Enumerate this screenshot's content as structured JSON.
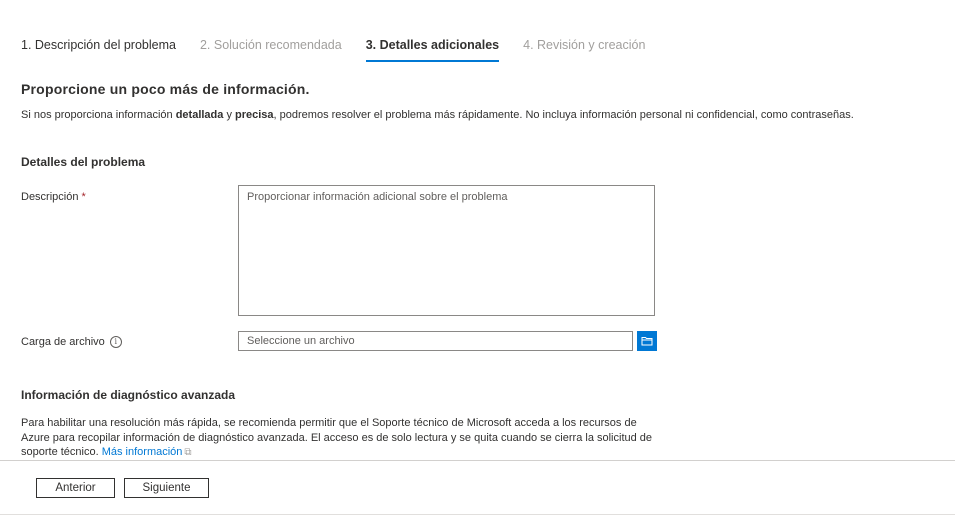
{
  "tabs": [
    {
      "label": "1. Descripción del problema",
      "state": "done"
    },
    {
      "label": "2. Solución recomendada",
      "state": "disabled"
    },
    {
      "label": "3. Detalles adicionales",
      "state": "active"
    },
    {
      "label": "4. Revisión y creación",
      "state": "disabled"
    }
  ],
  "page_title": "Proporcione un poco más de información.",
  "intro": {
    "part1": "Si nos proporciona información ",
    "bold1": "detallada",
    "part2": " y ",
    "bold2": "precisa",
    "part3": ", podremos resolver el problema más rápidamente. No incluya información personal ni confidencial, como contraseñas."
  },
  "problem_details": {
    "heading": "Detalles del problema",
    "description_label": "Descripción",
    "required_mark": "*",
    "description_placeholder": "Proporcionar información adicional sobre el problema",
    "file_label": "Carga de archivo",
    "info_glyph": "i",
    "file_placeholder": "Seleccione un archivo"
  },
  "diagnostics": {
    "heading": "Información de diagnóstico avanzada",
    "text": "Para habilitar una resolución más rápida, se recomienda permitir que el Soporte técnico de Microsoft acceda a los recursos de Azure para recopilar información de diagnóstico avanzada. El acceso es de solo lectura y se quita cuando se cierra la solicitud de soporte técnico. ",
    "link": "Más información",
    "ext_glyph": "⧉"
  },
  "footer": {
    "prev_label": "Anterior",
    "next_label": "Siguiente"
  },
  "colors": {
    "accent": "#0078d4",
    "required": "#a4262c",
    "text": "#323130",
    "muted": "#a19f9d"
  }
}
